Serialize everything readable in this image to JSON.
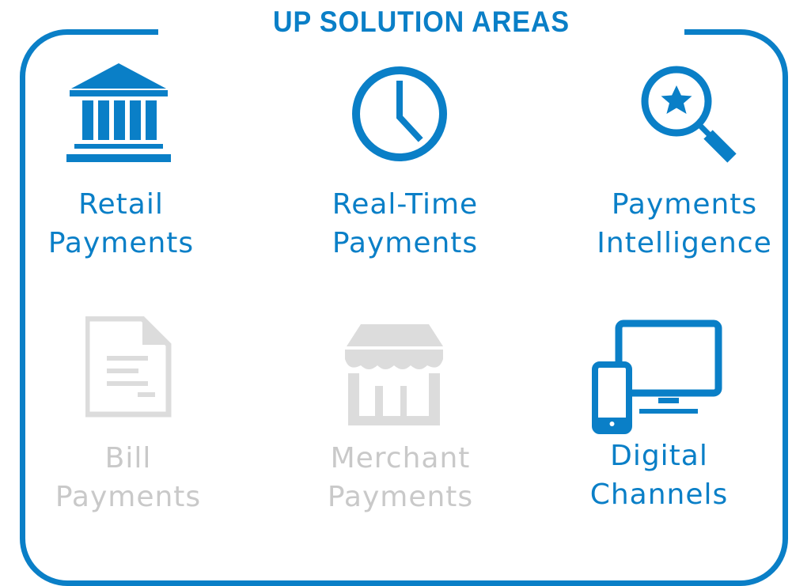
{
  "title": "UP SOLUTION AREAS",
  "colors": {
    "accent": "#0a7fc7",
    "inactive": "#c9c9c9",
    "inactive_icon": "#dcdcdc",
    "background": "#ffffff"
  },
  "tiles": [
    {
      "line1": "Retail",
      "line2": "Payments",
      "icon": "bank-icon",
      "state": "active"
    },
    {
      "line1": "Real-Time",
      "line2": "Payments",
      "icon": "clock-icon",
      "state": "active"
    },
    {
      "line1": "Payments",
      "line2": "Intelligence",
      "icon": "magnifier-star-icon",
      "state": "active"
    },
    {
      "line1": "Bill",
      "line2": "Payments",
      "icon": "document-icon",
      "state": "inactive"
    },
    {
      "line1": "Merchant",
      "line2": "Payments",
      "icon": "storefront-icon",
      "state": "inactive"
    },
    {
      "line1": "Digital",
      "line2": "Channels",
      "icon": "devices-icon",
      "state": "active"
    }
  ]
}
